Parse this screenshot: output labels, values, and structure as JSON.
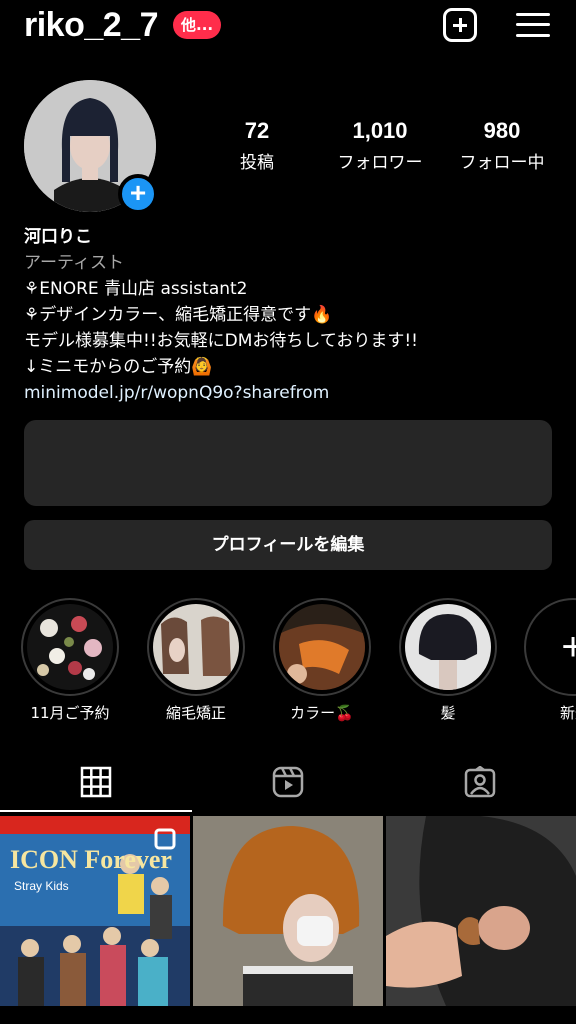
{
  "header": {
    "username": "riko_2_7",
    "other_badge": "他..."
  },
  "stats": [
    {
      "value": "72",
      "label": "投稿"
    },
    {
      "value": "1,010",
      "label": "フォロワー"
    },
    {
      "value": "980",
      "label": "フォロー中"
    }
  ],
  "profile": {
    "display_name": "河口りこ",
    "category": "アーティスト",
    "bio_lines": [
      "⚘ENORE 青山店 assistant2",
      "⚘デザインカラー、縮毛矯正得意です🔥",
      "モデル様募集中!!お気軽にDMお待ちしております!!",
      "↓ミニモからのご予約🙆"
    ],
    "link": "minimodel.jp/r/wopnQ9o?sharefrom"
  },
  "actions": {
    "edit_profile": "プロフィールを編集"
  },
  "highlights": [
    {
      "label": "11月ご予約"
    },
    {
      "label": "縮毛矯正"
    },
    {
      "label": "カラー🍒"
    },
    {
      "label": "髪"
    },
    {
      "label": "新規"
    }
  ],
  "posts": {
    "first_post_text": "ICON Forever",
    "first_post_subtext": "Stray Kids"
  },
  "colors": {
    "accent": "#1b95f5",
    "badge": "#ff2d4b",
    "panel": "#262626"
  }
}
